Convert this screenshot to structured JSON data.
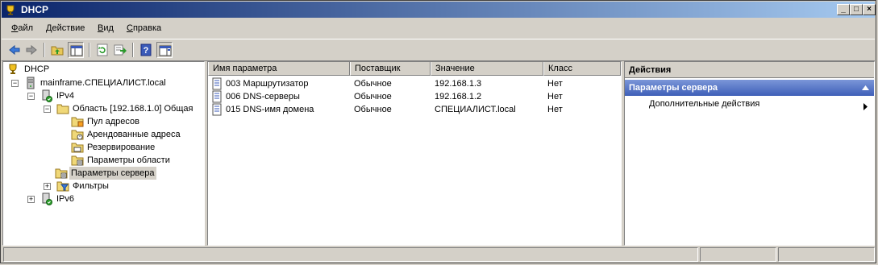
{
  "window": {
    "title": "DHCP",
    "controls": [
      "_",
      "□",
      "×"
    ]
  },
  "menu": [
    {
      "label": "Файл",
      "accel": "Ф",
      "rest": "айл"
    },
    {
      "label": "Действие",
      "accel": "Д",
      "rest": "ействие"
    },
    {
      "label": "Вид",
      "accel": "В",
      "rest": "ид"
    },
    {
      "label": "Справка",
      "accel": "С",
      "rest": "правка"
    }
  ],
  "toolbar": {
    "icons": [
      "back-arrow-icon",
      "forward-arrow-icon",
      "up-folder-icon",
      "show-hide-tree-icon",
      "refresh-icon",
      "export-list-icon",
      "help-icon",
      "action-pane-icon"
    ]
  },
  "tree": {
    "root": "DHCP",
    "server": "mainframe.СПЕЦИАЛИСТ.local",
    "ipv4": "IPv4",
    "scope": "Область [192.168.1.0] Общая",
    "pool": "Пул адресов",
    "leases": "Арендованные адреса",
    "reservations": "Резервирование",
    "scope_options": "Параметры области",
    "server_options": "Параметры сервера",
    "filters": "Фильтры",
    "ipv6": "IPv6"
  },
  "list": {
    "columns": [
      "Имя параметра",
      "Поставщик",
      "Значение",
      "Класс"
    ],
    "rows": [
      {
        "name": "003 Маршрутизатор",
        "vendor": "Обычное",
        "value": "192.168.1.3",
        "class": "Нет"
      },
      {
        "name": "006 DNS-серверы",
        "vendor": "Обычное",
        "value": "192.168.1.2",
        "class": "Нет"
      },
      {
        "name": "015 DNS-имя домена",
        "vendor": "Обычное",
        "value": "СПЕЦИАЛИСТ.local",
        "class": "Нет"
      }
    ]
  },
  "actions": {
    "header": "Действия",
    "section": "Параметры сервера",
    "more": "Дополнительные действия"
  },
  "colors": {
    "title_start": "#0a246a",
    "title_end": "#a6caf0",
    "action_section": "#3e5fb8",
    "face": "#d4d0c8"
  }
}
